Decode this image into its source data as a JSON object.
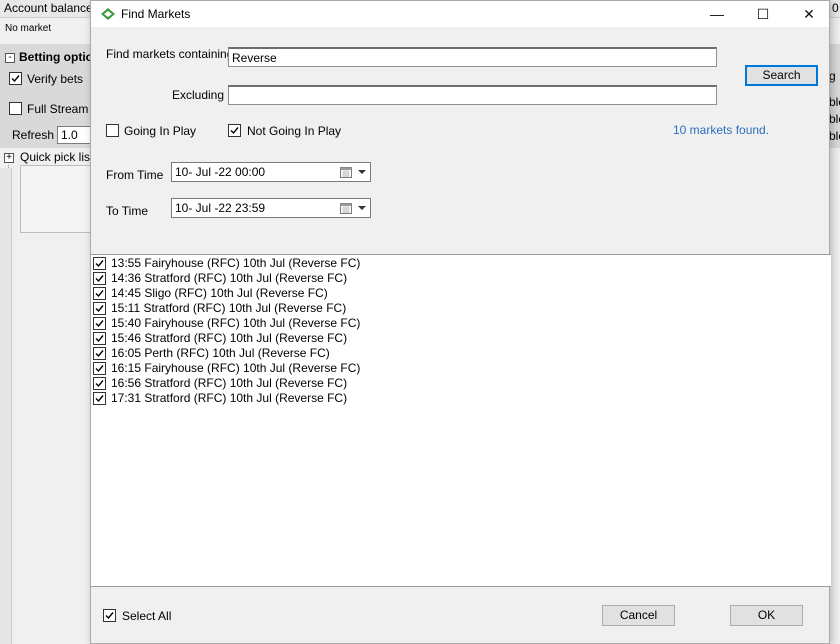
{
  "background": {
    "account_balance_label": "Account balance:",
    "top_right_char": "0",
    "no_market": "No market",
    "betting_options": "Betting optio",
    "verify_bets": "Verify bets",
    "full_stream": "Full Stream",
    "refresh_label": "Refresh",
    "refresh_value": "1.0",
    "quick_pick_list": "Quick pick list",
    "right_clip_1": "g",
    "right_clip_2": "ble",
    "right_clip_3": "ble",
    "right_clip_4": "ble"
  },
  "dialog": {
    "title": "Find Markets",
    "window_controls": {
      "minimize": "—",
      "maximize": "☐",
      "close": "✕"
    },
    "find_label": "Find markets containing",
    "find_value": "Reverse",
    "excluding_label": "Excluding",
    "excluding_value": "",
    "search_button": "Search",
    "going_in_play": {
      "label": "Going In Play",
      "checked": false
    },
    "not_going_in_play": {
      "label": "Not Going In Play",
      "checked": true
    },
    "found_text": "10 markets found.",
    "from_time_label": "From Time",
    "from_time_value": "10- Jul -22 00:00",
    "to_time_label": "To Time",
    "to_time_value": "10- Jul -22 23:59",
    "markets": [
      {
        "text": "13:55 Fairyhouse (RFC) 10th Jul (Reverse FC)",
        "checked": true
      },
      {
        "text": "14:36 Stratford (RFC) 10th Jul (Reverse FC)",
        "checked": true
      },
      {
        "text": "14:45 Sligo (RFC) 10th Jul (Reverse FC)",
        "checked": true
      },
      {
        "text": "15:11 Stratford (RFC) 10th Jul (Reverse FC)",
        "checked": true
      },
      {
        "text": "15:40 Fairyhouse (RFC) 10th Jul (Reverse FC)",
        "checked": true
      },
      {
        "text": "15:46 Stratford (RFC) 10th Jul (Reverse FC)",
        "checked": true
      },
      {
        "text": "16:05 Perth (RFC) 10th Jul (Reverse FC)",
        "checked": true
      },
      {
        "text": "16:15 Fairyhouse (RFC) 10th Jul (Reverse FC)",
        "checked": true
      },
      {
        "text": "16:56 Stratford (RFC) 10th Jul (Reverse FC)",
        "checked": true
      },
      {
        "text": "17:31 Stratford (RFC) 10th Jul (Reverse FC)",
        "checked": true
      }
    ],
    "select_all": {
      "label": "Select All",
      "checked": true
    },
    "cancel_button": "Cancel",
    "ok_button": "OK"
  },
  "colors": {
    "accent": "#0078d7",
    "found_text": "#2f6fbe",
    "icon_green": "#3c9a3c"
  },
  "icons": {
    "app": "diamond-logo-icon",
    "calendar": "calendar-icon",
    "check": "check-icon"
  }
}
